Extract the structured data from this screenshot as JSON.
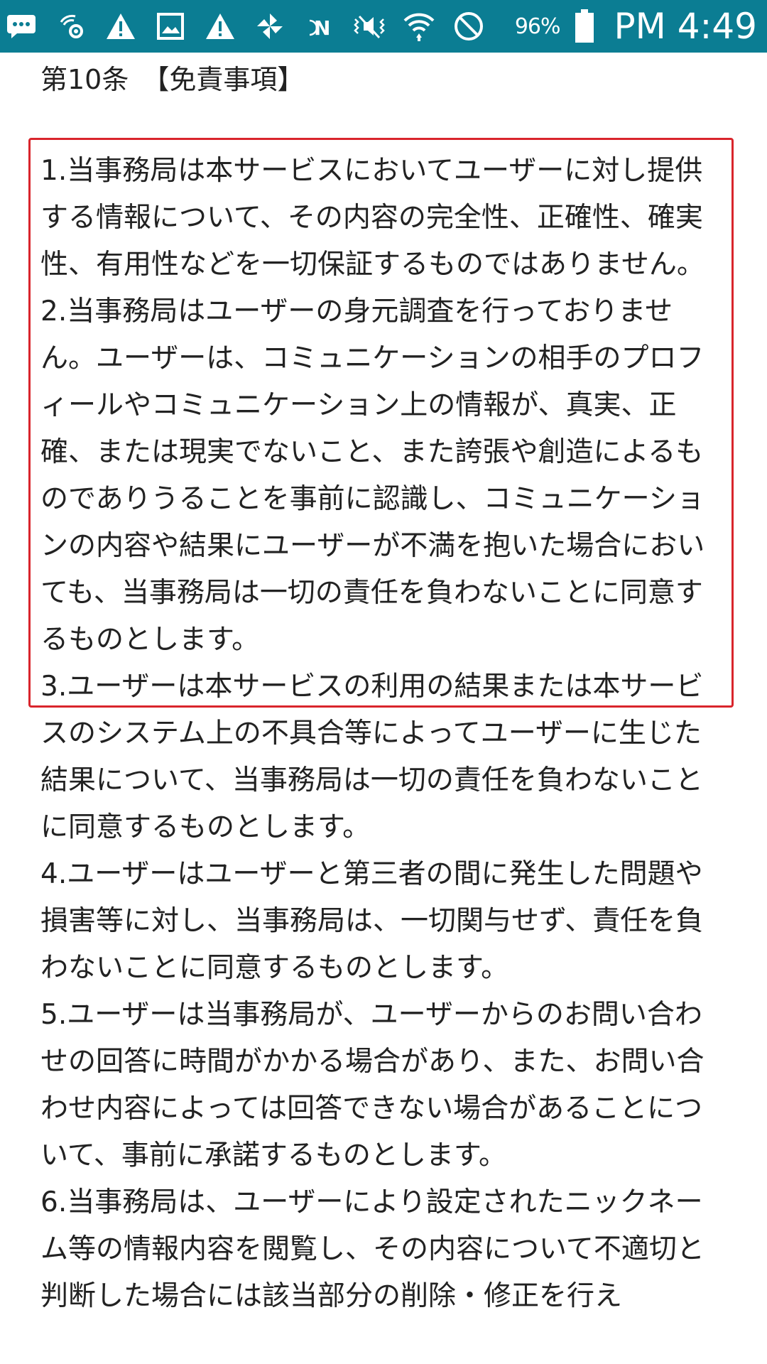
{
  "status_bar": {
    "icons": [
      "more-icon",
      "signal-setting-icon",
      "warning-icon",
      "gallery-icon",
      "warning-icon",
      "pinwheel-icon",
      "nfc-icon",
      "vibrate-mute-icon",
      "wifi-icon",
      "block-icon",
      "battery-icon"
    ],
    "battery_percent": "96%",
    "time": "PM 4:49",
    "background_color": "#0b7d93"
  },
  "article": {
    "heading": "第10条　【免責事項】",
    "highlight_color": "#d9252c",
    "items": [
      "1.当事務局は本サービスにおいてユーザーに対し提供する情報について、その内容の完全性、正確性、確実性、有用性などを一切保証するものではありません。",
      "2.当事務局はユーザーの身元調査を行っておりません。ユーザーは、コミュニケーションの相手のプロフィールやコミュニケーション上の情報が、真実、正確、または現実でないこと、また誇張や創造によるものでありうることを事前に認識し、コミュニケーションの内容や結果にユーザーが不満を抱いた場合においても、当事務局は一切の責任を負わないことに同意するものとします。",
      "3.ユーザーは本サービスの利用の結果または本サービスのシステム上の不具合等によってユーザーに生じた結果について、当事務局は一切の責任を負わないことに同意するものとします。",
      "4.ユーザーはユーザーと第三者の間に発生した問題や損害等に対し、当事務局は、一切関与せず、責任を負わないことに同意するものとします。",
      "5.ユーザーは当事務局が、ユーザーからのお問い合わせの回答に時間がかかる場合があり、また、お問い合わせ内容によっては回答できない場合があることについて、事前に承諾するものとします。",
      "6.当事務局は、ユーザーにより設定されたニックネーム等の情報内容を閲覧し、その内容について不適切と判断した場合には該当部分の削除・修正を行え"
    ]
  }
}
